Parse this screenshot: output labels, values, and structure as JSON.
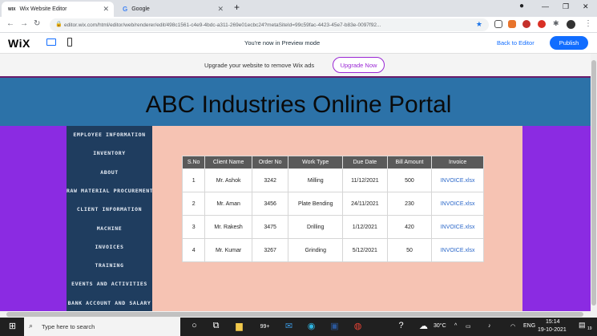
{
  "browser": {
    "tabs": [
      {
        "favicon": "WIX",
        "title": "Wix Website Editor",
        "active": true
      },
      {
        "favicon": "G",
        "title": "Google",
        "active": false
      }
    ],
    "new_tab": "+",
    "url": "editor.wix.com/html/editor/web/renderer/edit/498c1561-c4e9-4bdc-a311-269e01ecbc24?metaSiteId=99c59fac-4423-45e7-b83e-0097f92..."
  },
  "wix": {
    "logo": "WiX",
    "preview_message": "You're now in Preview mode",
    "back_to_editor": "Back to Editor",
    "publish": "Publish",
    "upgrade_message": "Upgrade your website to remove Wix ads",
    "upgrade_button": "Upgrade Now"
  },
  "site": {
    "title": "ABC Industries Online Portal",
    "menu": [
      "EMPLOYEE INFORMATION",
      "INVENTORY",
      "ABOUT",
      "RAW MATERIAL PROCUREMENT",
      "CLIENT INFORMATION",
      "MACHINE",
      "INVOICES",
      "TRAINING",
      "EVENTS AND ACTIVITIES",
      "BANK ACCOUNT AND SALARY"
    ],
    "table": {
      "headers": [
        "S.No",
        "Client Name",
        "Order No",
        "Work Type",
        "Due Date",
        "Bill Amount",
        "Invoice"
      ],
      "rows": [
        [
          "1",
          "Mr. Ashok",
          "3242",
          "Milling",
          "11/12/2021",
          "500",
          "INVOICE.xlsx"
        ],
        [
          "2",
          "Mr. Aman",
          "3456",
          "Plate Bending",
          "24/11/2021",
          "230",
          "INVOICE.xlsx"
        ],
        [
          "3",
          "Mr. Rakesh",
          "3475",
          "Drilling",
          "1/12/2021",
          "420",
          "INVOICE.xlsx"
        ],
        [
          "4",
          "Mr. Kumar",
          "3267",
          "Grinding",
          "5/12/2021",
          "50",
          "INVOICE.xlsx"
        ]
      ]
    }
  },
  "taskbar": {
    "search_placeholder": "Type here to search",
    "weather": "30°C",
    "language": "ENG",
    "time": "15:14",
    "date": "19-10-2021",
    "notification_count": "99+",
    "action_center_count": "19"
  }
}
